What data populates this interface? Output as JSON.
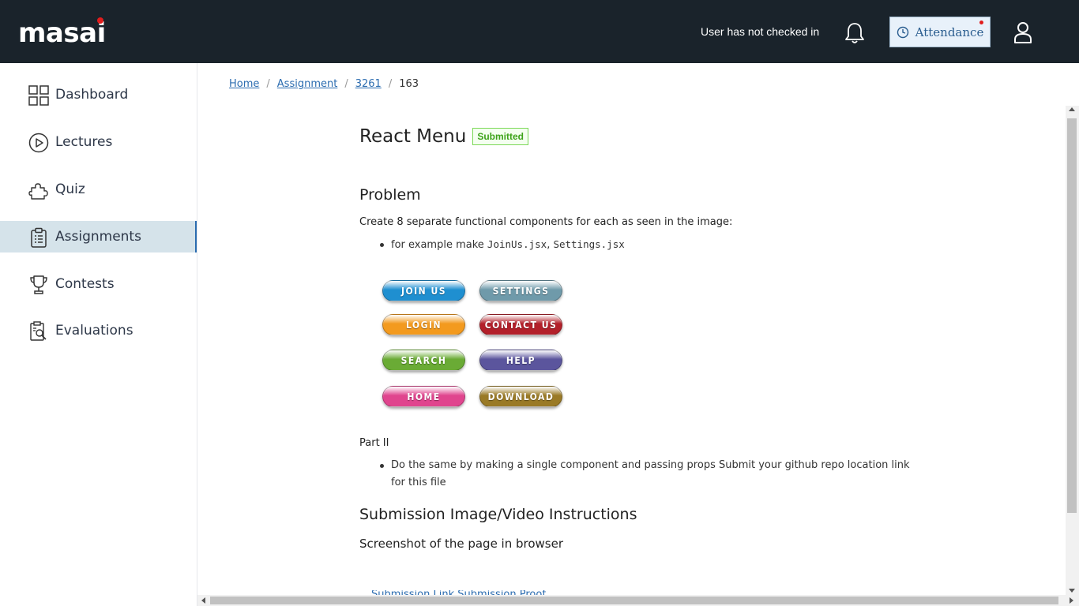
{
  "header": {
    "logo_text": "masai",
    "checkin_status": "User has not checked in",
    "attendance_label": "Attendance",
    "icons": [
      "bell-icon",
      "clock-icon",
      "user-icon"
    ]
  },
  "sidebar": {
    "items": [
      {
        "label": "Dashboard",
        "icon": "grid-icon"
      },
      {
        "label": "Lectures",
        "icon": "play-circle-icon"
      },
      {
        "label": "Quiz",
        "icon": "puzzle-icon"
      },
      {
        "label": "Assignments",
        "icon": "clipboard-icon",
        "active": true
      },
      {
        "label": "Contests",
        "icon": "trophy-icon"
      },
      {
        "label": "Evaluations",
        "icon": "report-search-icon"
      }
    ]
  },
  "breadcrumb": {
    "home": "Home",
    "assignment": "Assignment",
    "id": "3261",
    "current": "163"
  },
  "assignment": {
    "title": "React Menu",
    "status": "Submitted",
    "problem_heading": "Problem",
    "problem_intro": "Create 8 separate functional components for each as seen in the image:",
    "example_prefix": "for example make ",
    "example_file_1": "JoinUs.jsx",
    "example_sep": ", ",
    "example_file_2": "Settings.jsx",
    "menu_buttons": [
      {
        "label": "JOIN US",
        "color": "#1f8fd0"
      },
      {
        "label": "SETTINGS",
        "color": "#6f9aaa"
      },
      {
        "label": "LOGIN",
        "color": "#f39a1e"
      },
      {
        "label": "CONTACT US",
        "color": "#b3202a"
      },
      {
        "label": "SEARCH",
        "color": "#6aab35"
      },
      {
        "label": "HELP",
        "color": "#5b559d"
      },
      {
        "label": "HOME",
        "color": "#e0458e"
      },
      {
        "label": "DOWNLOAD",
        "color": "#9a7a26"
      }
    ],
    "part2_heading": "Part II",
    "part2_item": "Do the same by making a single component and passing props Submit your github repo location link for this file",
    "submission_heading": "Submission Image/Video Instructions",
    "submission_text": "Screenshot of the page in browser",
    "cutoff_text": "Submission Link      Submission Proof"
  },
  "colors": {
    "topbar": "#1a232b",
    "accent_red": "#e11d1d",
    "link": "#2b6cb0",
    "active_nav": "#d5e3ea",
    "submitted_green": "#3da31a"
  }
}
